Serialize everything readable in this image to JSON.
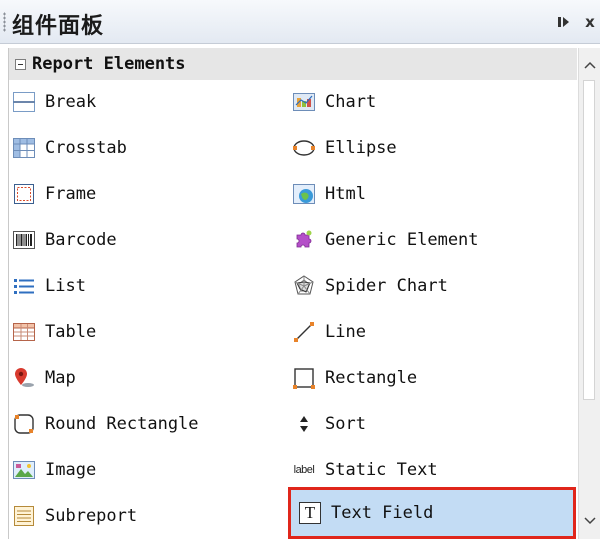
{
  "window": {
    "title": "组件面板",
    "minimize_icon": "collapse-icon",
    "close_label": "x"
  },
  "section": {
    "label": "Report Elements",
    "toggle_icon": "collapse-minus-icon"
  },
  "items": [
    {
      "label": "Break",
      "icon": "break-icon"
    },
    {
      "label": "Chart",
      "icon": "chart-icon"
    },
    {
      "label": "Crosstab",
      "icon": "crosstab-icon"
    },
    {
      "label": "Ellipse",
      "icon": "ellipse-icon"
    },
    {
      "label": "Frame",
      "icon": "frame-icon"
    },
    {
      "label": "Html",
      "icon": "html-icon"
    },
    {
      "label": "Barcode",
      "icon": "barcode-icon"
    },
    {
      "label": "Generic Element",
      "icon": "puzzle-icon"
    },
    {
      "label": "List",
      "icon": "list-icon"
    },
    {
      "label": "Spider Chart",
      "icon": "spider-chart-icon"
    },
    {
      "label": "Table",
      "icon": "table-icon"
    },
    {
      "label": "Line",
      "icon": "line-icon"
    },
    {
      "label": "Map",
      "icon": "map-pin-icon"
    },
    {
      "label": "Rectangle",
      "icon": "rectangle-icon"
    },
    {
      "label": "Round Rectangle",
      "icon": "round-rectangle-icon"
    },
    {
      "label": "Sort",
      "icon": "sort-icon"
    },
    {
      "label": "Image",
      "icon": "image-icon"
    },
    {
      "label": "Static Text",
      "icon": "label-icon",
      "icon_text": "label"
    },
    {
      "label": "Subreport",
      "icon": "subreport-icon"
    },
    {
      "label": "Text Field",
      "icon": "text-field-icon",
      "icon_text": "T",
      "selected": true
    }
  ],
  "colors": {
    "selection_bg": "#c3dcf4",
    "selection_outline": "#e0261b",
    "section_bg": "#e6e6e6"
  }
}
